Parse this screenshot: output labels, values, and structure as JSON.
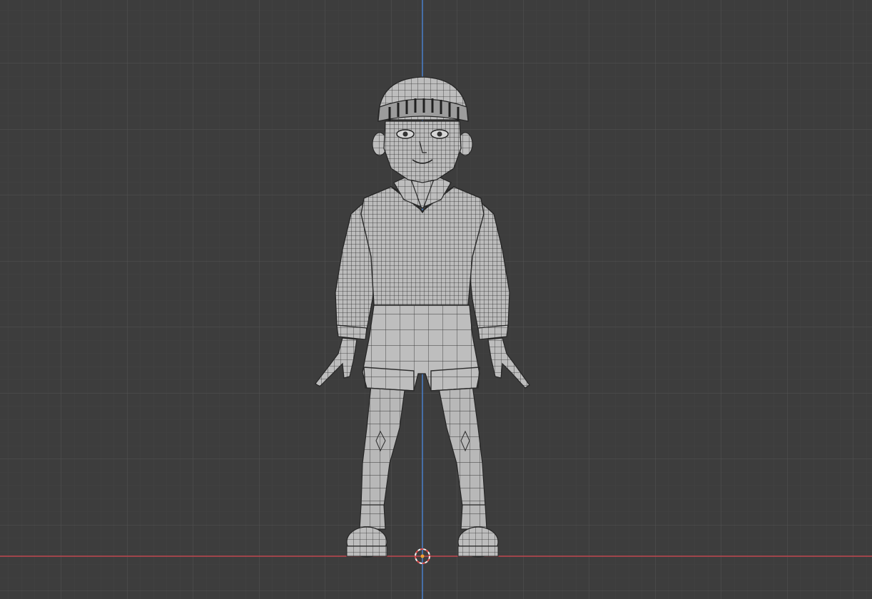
{
  "viewport": {
    "view": "front-orthographic",
    "shading": "solid-wireframe-overlay",
    "subject": "stylized-child-character-mesh",
    "colors": {
      "background": "#3d3d3d",
      "grid_minor": "#444444",
      "grid_major": "#535353",
      "axis_x": "#c0474f",
      "axis_z": "#4a7fc9",
      "mesh_fill": "#b9b9b9",
      "mesh_wire": "#2b2b2b",
      "cursor_ring_a": "#e25050",
      "cursor_ring_b": "#f2f2f2",
      "cursor_dot": "#f0a030"
    },
    "icons": {
      "cursor": "3d-cursor-icon"
    }
  }
}
